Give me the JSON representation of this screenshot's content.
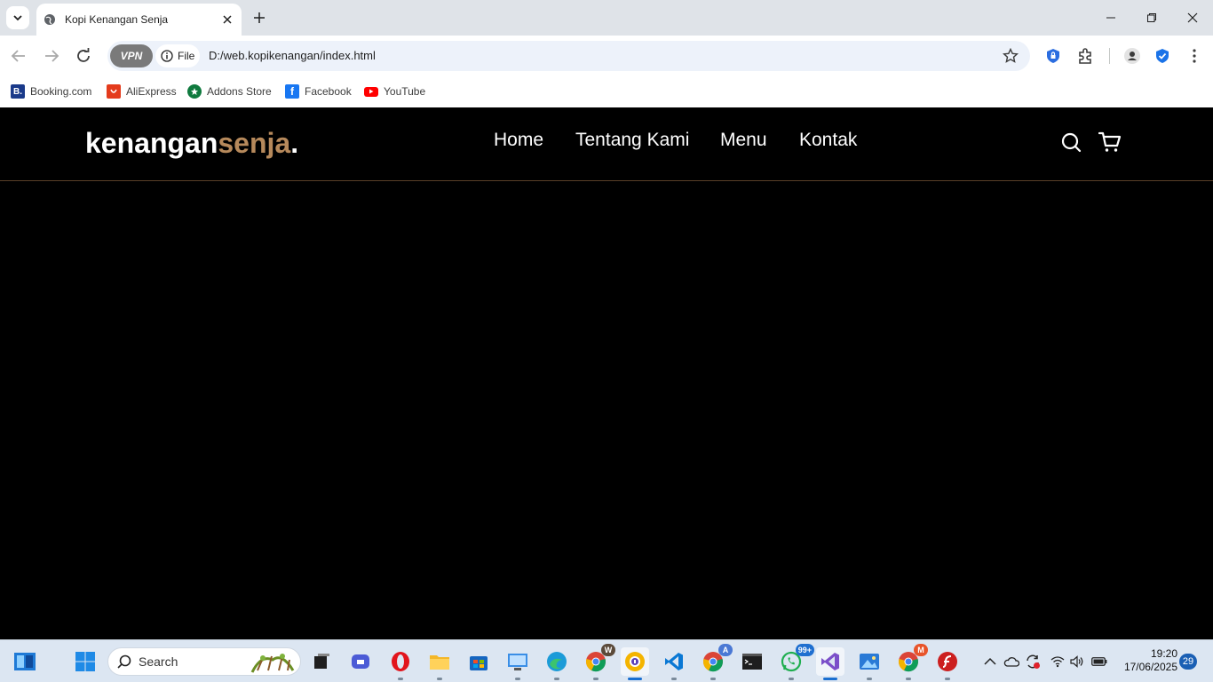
{
  "browser": {
    "tab": {
      "title": "Kopi Kenangan Senja"
    },
    "omnibox": {
      "vpn_label": "VPN",
      "site_info_label": "File",
      "url": "D:/web.kopikenangan/index.html"
    },
    "bookmarks": [
      {
        "label": "Booking.com",
        "icon": "booking-icon",
        "color": "#1a3a8a",
        "glyph": "B."
      },
      {
        "label": "AliExpress",
        "icon": "aliexpress-icon",
        "color": "#e43b1c",
        "glyph": ""
      },
      {
        "label": "Addons Store",
        "icon": "addons-store-icon",
        "color": "#0f7a3e",
        "glyph": ""
      },
      {
        "label": "Facebook",
        "icon": "facebook-icon",
        "color": "#1877f2",
        "glyph": "f"
      },
      {
        "label": "YouTube",
        "icon": "youtube-icon",
        "color": "#ff0000",
        "glyph": ""
      }
    ]
  },
  "site": {
    "logo": {
      "part1": "kenangan",
      "part2": "senja",
      "part3": "."
    },
    "nav_links": [
      "Home",
      "Tentang Kami",
      "Menu",
      "Kontak"
    ],
    "accent_color": "#b6895b"
  },
  "taskbar": {
    "search_placeholder": "Search",
    "badges": {
      "chrome1": "W",
      "chrome2": "A",
      "whatsapp": "99+",
      "chrome3": "M"
    },
    "clock": {
      "time": "19:20",
      "date": "17/06/2025"
    },
    "notification_count": "29"
  }
}
